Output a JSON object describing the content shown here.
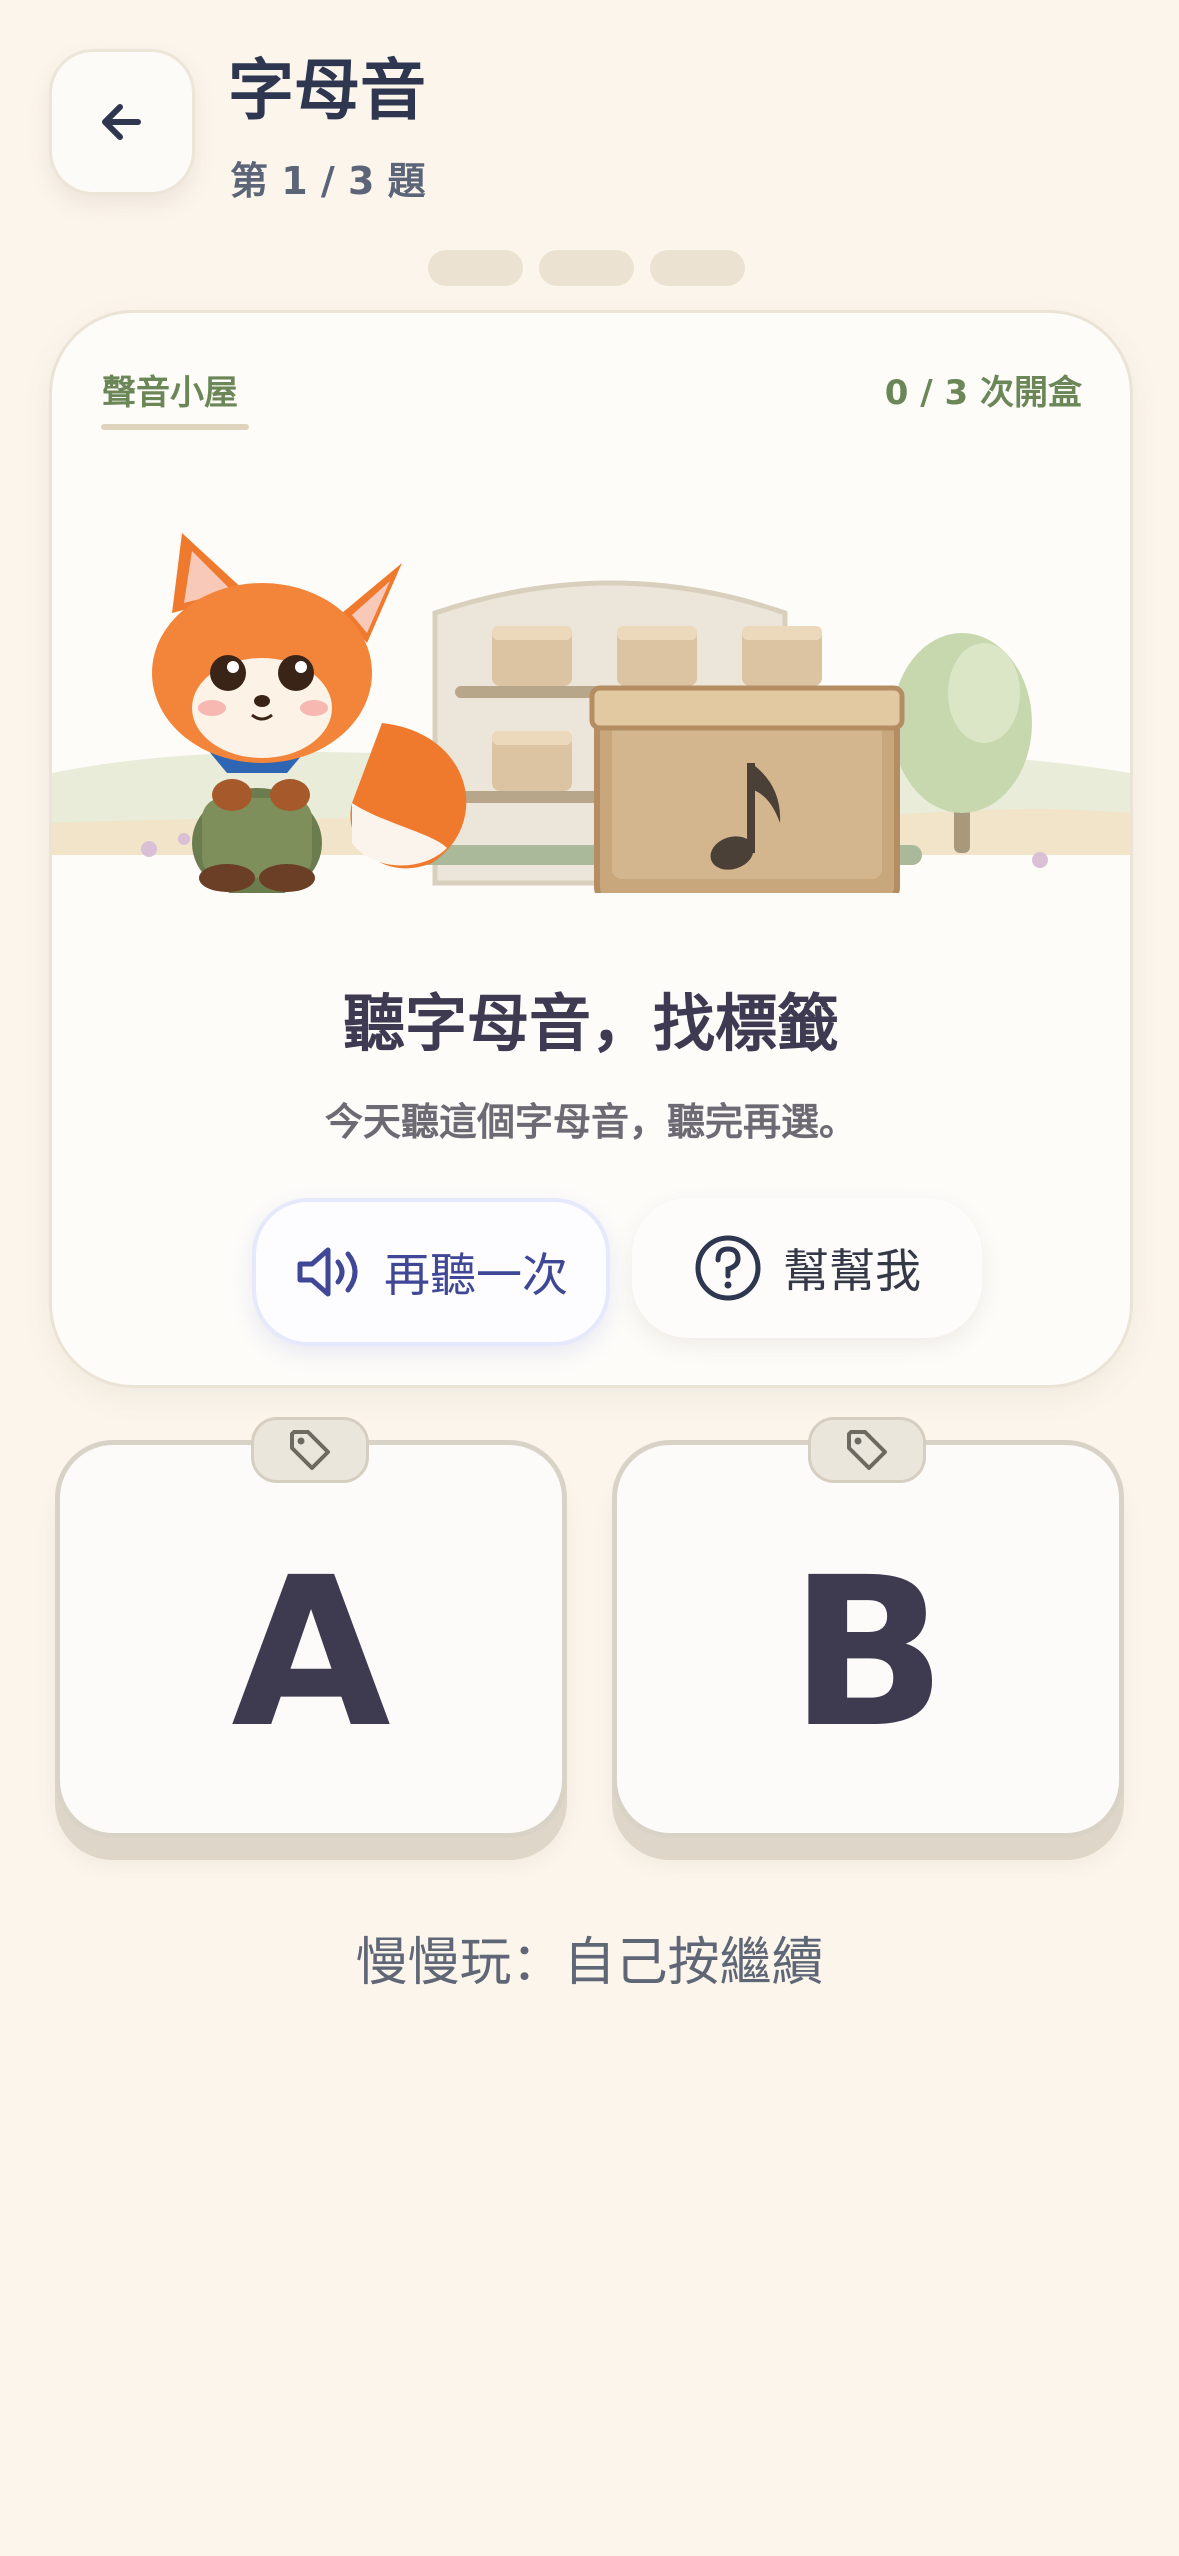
{
  "header": {
    "back_icon": "arrow-left-icon",
    "title": "字母音",
    "progress_text": "第 1 / 3 題",
    "step_dots": 3
  },
  "card": {
    "section_label": "聲音小屋",
    "box_count": "0 / 3 次開盒",
    "scene_icon": "music-note-icon",
    "heading": "聽字母音，找標籤",
    "description": "今天聽這個字母音，聽完再選。",
    "replay_label": "再聽一次",
    "replay_icon": "speaker-icon",
    "help_label": "幫幫我",
    "help_icon": "question-circle-icon"
  },
  "options": [
    {
      "letter": "A",
      "icon": "tag-icon"
    },
    {
      "letter": "B",
      "icon": "tag-icon"
    }
  ],
  "footer": {
    "mode_text": "慢慢玩：自己按繼續"
  },
  "colors": {
    "background": "#fbf5ec",
    "accent_green": "#6b8758",
    "accent_blue": "#3f4796",
    "text_dark": "#2e3650"
  }
}
